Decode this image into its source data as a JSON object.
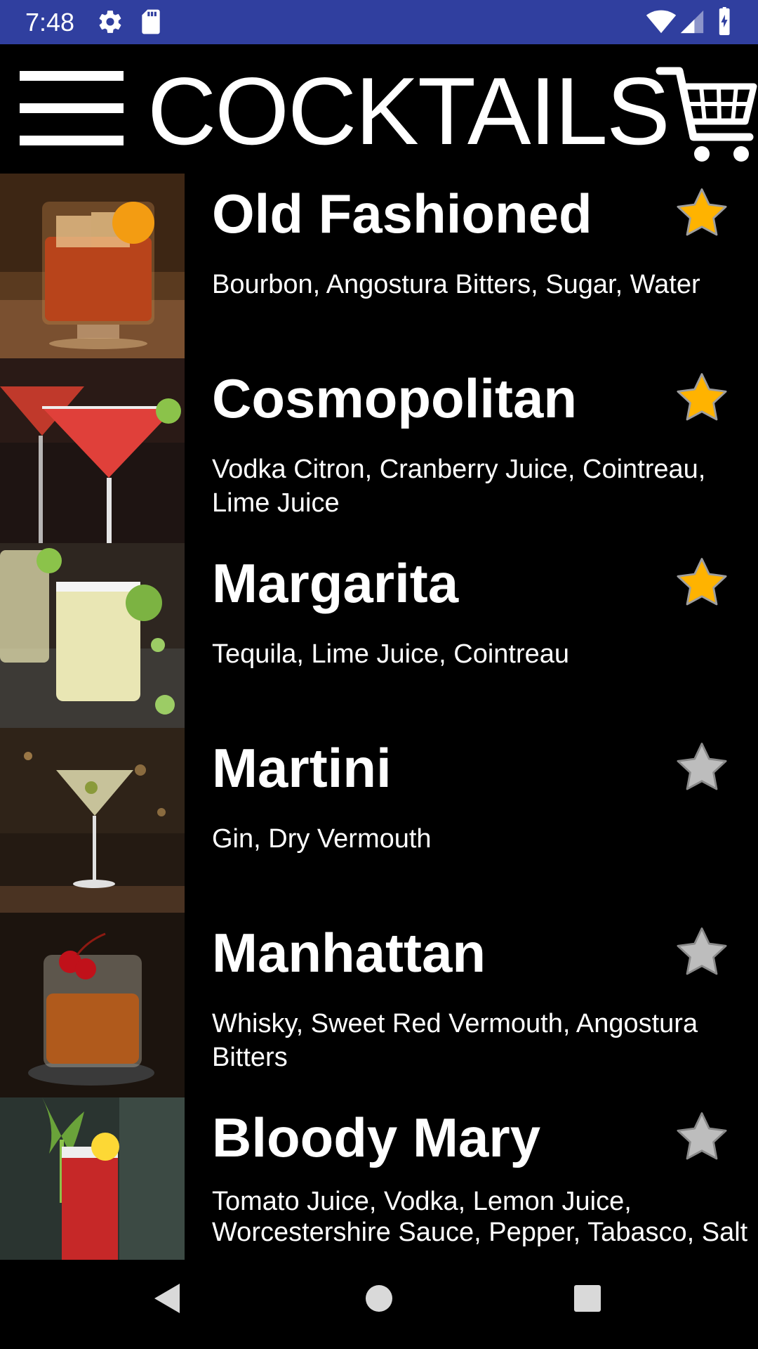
{
  "status_bar": {
    "time": "7:48",
    "background": "#303F9F",
    "icons": [
      "gear-icon",
      "sd-card-icon",
      "wifi-icon",
      "signal-icon",
      "battery-icon"
    ]
  },
  "app_bar": {
    "title": "COCKTAILS",
    "menu_icon": "hamburger-menu-icon",
    "cart_icon": "shopping-cart-icon"
  },
  "cocktails": [
    {
      "name": "Old Fashioned",
      "ingredients": "Bourbon, Angostura Bitters, Sugar, Water",
      "favorite": true
    },
    {
      "name": "Cosmopolitan",
      "ingredients": "Vodka Citron, Cranberry Juice, Cointreau, Lime Juice",
      "favorite": true
    },
    {
      "name": "Margarita",
      "ingredients": "Tequila, Lime Juice, Cointreau",
      "favorite": true
    },
    {
      "name": "Martini",
      "ingredients": "Gin, Dry Vermouth",
      "favorite": false
    },
    {
      "name": "Manhattan",
      "ingredients": "Whisky, Sweet Red Vermouth, Angostura Bitters",
      "favorite": false
    },
    {
      "name": "Bloody Mary",
      "ingredients": "Tomato Juice, Vodka, Lemon Juice, Worcestershire Sauce, Pepper, Tabasco, Salt",
      "favorite": false
    }
  ],
  "nav_bar": {
    "icons": [
      "back-icon",
      "home-icon",
      "recents-icon"
    ]
  },
  "colors": {
    "favorite_star": "#FFB300",
    "unfavorite_star": "#BDBDBD",
    "background": "#000000",
    "text": "#FFFFFF"
  }
}
